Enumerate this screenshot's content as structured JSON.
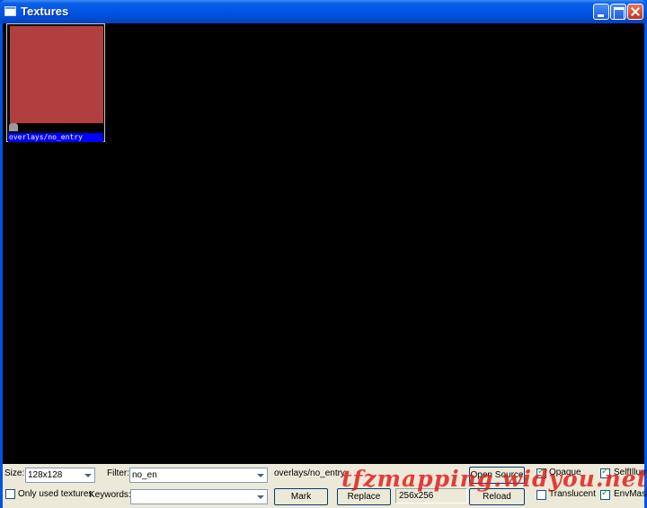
{
  "window": {
    "title": "Textures"
  },
  "textures": [
    {
      "name": "overlays/no_entry",
      "color": "#b13f3f"
    }
  ],
  "toolbar": {
    "size_label": "Size:",
    "size_value": "128x128",
    "filter_label": "Filter:",
    "filter_value": "no_en",
    "current_texture": "overlays/no_entry",
    "open_source_label": "Open Source",
    "opaque_label": "Opaque",
    "opaque_checked": true,
    "selfillum_label": "SelfIllum",
    "selfillum_checked": true,
    "only_used_label": "Only used textures",
    "only_used_checked": false,
    "keywords_label": "Keywords:",
    "keywords_value": "",
    "mark_label": "Mark",
    "replace_label": "Replace",
    "texture_size": "256x256",
    "reload_label": "Reload",
    "translucent_label": "Translucent",
    "translucent_checked": false,
    "envmask_label": "EnvMask",
    "envmask_checked": true
  },
  "watermark": "tfzmapping.widyou.net",
  "colors": {
    "canvas": "#000000",
    "selection": "#0000ff",
    "toolbar": "#ece9d8",
    "watermark": "#e01818"
  }
}
